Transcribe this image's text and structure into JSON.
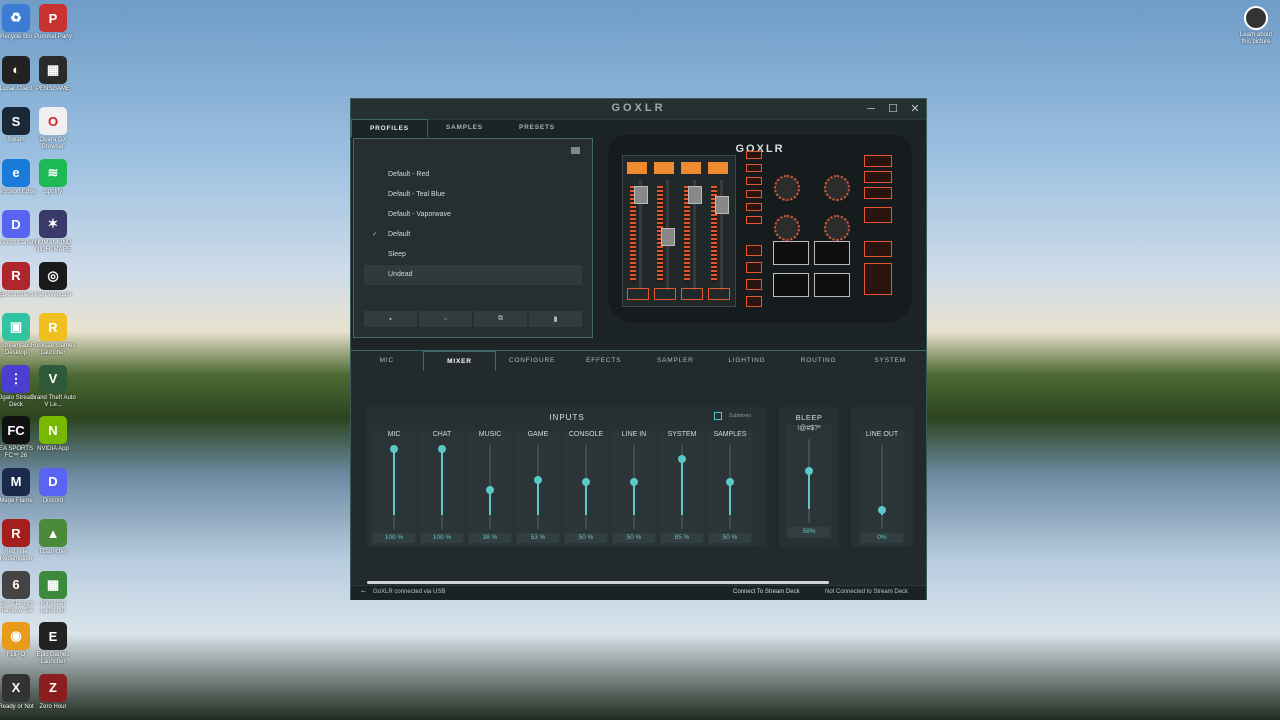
{
  "desktop": {
    "icons_col1": [
      {
        "label": "Recycle Bin",
        "color": "#3d7bd4",
        "glyph": "♻"
      },
      {
        "label": "Lunar Client",
        "color": "#222222",
        "glyph": "◐"
      },
      {
        "label": "Steam",
        "color": "#1b2838",
        "glyph": "S"
      },
      {
        "label": "Microsoft Edge",
        "color": "#1b7bd8",
        "glyph": "e"
      },
      {
        "label": "Discord Canary",
        "color": "#5865f2",
        "glyph": "D"
      },
      {
        "label": "EpicGrinders",
        "color": "#b0262d",
        "glyph": "R"
      },
      {
        "label": "Streamlabs Desktop",
        "color": "#31c3a2",
        "glyph": "▣"
      },
      {
        "label": "Elgato Stream Deck",
        "color": "#4b3fd1",
        "glyph": "⋮"
      },
      {
        "label": "EA SPORTS FC™ 26",
        "color": "#111111",
        "glyph": "FC"
      },
      {
        "label": "Mage Flame",
        "color": "#1a2a4a",
        "glyph": "M"
      },
      {
        "label": "Red Nite Redemption",
        "color": "#a51d1d",
        "glyph": "R"
      },
      {
        "label": "Tom Clancy's Rainbow Six",
        "color": "#444444",
        "glyph": "6"
      },
      {
        "label": "FLiP O",
        "color": "#e89a1b",
        "glyph": "◉"
      },
      {
        "label": "Ready or Not",
        "color": "#333333",
        "glyph": "X"
      }
    ],
    "icons_col2": [
      {
        "label": "Pummel Party",
        "color": "#c8322f",
        "glyph": "P"
      },
      {
        "label": "PENSGAME",
        "color": "#2a2a2a",
        "glyph": "▦"
      },
      {
        "label": "Opera GX Browser",
        "color": "#f0f0f0",
        "glyph": "O"
      },
      {
        "label": "Spotify",
        "color": "#1db954",
        "glyph": "≋"
      },
      {
        "label": "HUMANKIND NIGHTMARE",
        "color": "#3a3a6a",
        "glyph": "✶"
      },
      {
        "label": "Iriun Webcam",
        "color": "#1a1a1a",
        "glyph": "◎"
      },
      {
        "label": "Rockstar Games Launcher",
        "color": "#f0c020",
        "glyph": "R"
      },
      {
        "label": "Grand Theft Auto V Le...",
        "color": "#2f5a3a",
        "glyph": "V"
      },
      {
        "label": "NVIDIA App",
        "color": "#76b900",
        "glyph": "N"
      },
      {
        "label": "Discord",
        "color": "#5865f2",
        "glyph": "D"
      },
      {
        "label": "TLauncher",
        "color": "#4a8a3a",
        "glyph": "▲"
      },
      {
        "label": "Minecraft Launcher",
        "color": "#3c8a3c",
        "glyph": "▦"
      },
      {
        "label": "Epic Games Launcher",
        "color": "#222222",
        "glyph": "E"
      },
      {
        "label": "Zero Hour",
        "color": "#8a1e1e",
        "glyph": "Z"
      }
    ],
    "learn_about": "Learn about\nthis picture"
  },
  "window": {
    "logo": "GOXLR",
    "controls": {
      "minimize": "─",
      "maximize": "☐",
      "close": "✕"
    },
    "top_tabs": [
      {
        "label": "PROFILES",
        "active": true
      },
      {
        "label": "SAMPLES",
        "active": false
      },
      {
        "label": "PRESETS",
        "active": false
      }
    ],
    "profiles": [
      {
        "name": "Default - Red",
        "checked": false,
        "selected": false
      },
      {
        "name": "Default - Teal Blue",
        "checked": false,
        "selected": false
      },
      {
        "name": "Default - Vaporwave",
        "checked": false,
        "selected": false
      },
      {
        "name": "Default",
        "checked": true,
        "selected": false
      },
      {
        "name": "Sleep",
        "checked": false,
        "selected": false
      },
      {
        "name": "Undead",
        "checked": false,
        "selected": true
      }
    ],
    "profile_buttons": [
      {
        "name": "save",
        "glyph": "▪"
      },
      {
        "name": "new",
        "glyph": "▫"
      },
      {
        "name": "copy",
        "glyph": "⧉"
      },
      {
        "name": "delete",
        "glyph": "▮"
      }
    ],
    "device_logo": "GOXLR",
    "bottom_tabs": [
      {
        "label": "MIC",
        "active": false
      },
      {
        "label": "MIXER",
        "active": true
      },
      {
        "label": "CONFIGURE",
        "active": false
      },
      {
        "label": "EFFECTS",
        "active": false
      },
      {
        "label": "SAMPLER",
        "active": false
      },
      {
        "label": "LIGHTING",
        "active": false
      },
      {
        "label": "ROUTING",
        "active": false
      },
      {
        "label": "SYSTEM",
        "active": false
      }
    ],
    "mixer": {
      "inputs_title": "INPUTS",
      "submixes_label": "Submixes",
      "channels": [
        {
          "name": "MIC",
          "value_text": "100 %",
          "level": 1.0
        },
        {
          "name": "CHAT",
          "value_text": "100 %",
          "level": 1.0
        },
        {
          "name": "MUSIC",
          "value_text": "38 %",
          "level": 0.38
        },
        {
          "name": "GAME",
          "value_text": "53 %",
          "level": 0.53
        },
        {
          "name": "CONSOLE",
          "value_text": "50 %",
          "level": 0.5
        },
        {
          "name": "LINE IN",
          "value_text": "50 %",
          "level": 0.5
        },
        {
          "name": "SYSTEM",
          "value_text": "85 %",
          "level": 0.85
        },
        {
          "name": "SAMPLES",
          "value_text": "50 %",
          "level": 0.5
        }
      ],
      "bleep": {
        "title": "BLEEP",
        "name": "!@#$?*",
        "value_text": "58%",
        "level": 0.58
      },
      "outputs": {
        "name": "LINE OUT",
        "value_text": "0%",
        "level": 0.08
      }
    },
    "status": {
      "usb_icon": "⭠",
      "usb_text": "GoXLR connected via USB",
      "connect_text": "Connect To Stream Deck",
      "not_connected_text": "Not Connected to Stream Deck",
      "grip_icon": "⁞⁞"
    },
    "accent_color": "#5cc8c8",
    "device_accent": "#e4572e"
  }
}
